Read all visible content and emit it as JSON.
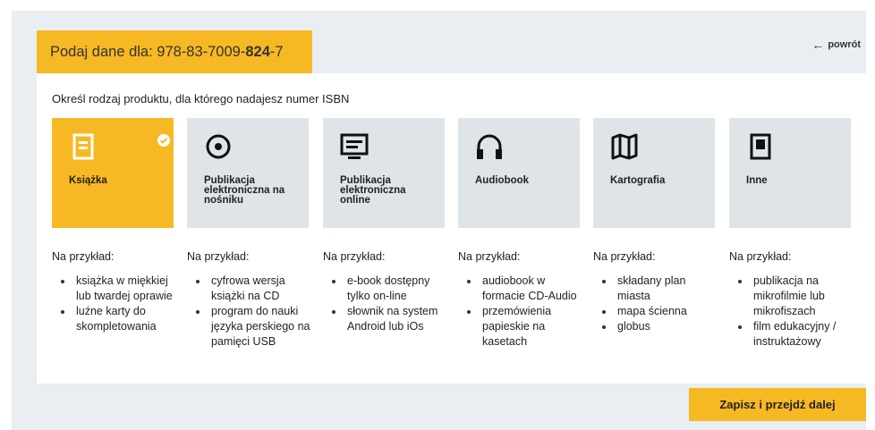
{
  "header": {
    "prefix": "Podaj dane dla: 978-83-7009-",
    "bold": "824",
    "suffix": "-7",
    "back_label": "powrót"
  },
  "intro": "Określ rodzaj produktu, dla którego nadajesz numer ISBN",
  "cards": [
    {
      "label": "Książka",
      "icon": "book-icon",
      "selected": true
    },
    {
      "label": "Publikacja elektroniczna na nośniku",
      "icon": "disc-icon",
      "selected": false
    },
    {
      "label": "Publikacja elektroniczna online",
      "icon": "monitor-icon",
      "selected": false
    },
    {
      "label": "Audiobook",
      "icon": "headphones-icon",
      "selected": false
    },
    {
      "label": "Kartografia",
      "icon": "map-icon",
      "selected": false
    },
    {
      "label": "Inne",
      "icon": "document-icon",
      "selected": false
    }
  ],
  "examples_title": "Na przykład:",
  "examples": [
    {
      "items": [
        "książka w miękkiej lub twardej oprawie",
        "luźne karty do skompletowania"
      ]
    },
    {
      "items": [
        "cyfrowa wersja książki na CD",
        "program do nauki języka perskiego na pamięci USB"
      ]
    },
    {
      "items": [
        "e-book dostępny tylko on-line",
        "słownik na system Android lub iOs"
      ]
    },
    {
      "items": [
        "audiobook w formacie CD-Audio",
        "przemówienia papieskie na kasetach"
      ]
    },
    {
      "items": [
        "składany plan miasta",
        "mapa ścienna",
        "globus"
      ]
    },
    {
      "items": [
        "publikacja na mikrofilmie lub mikrofiszach",
        "film edukacyjny / instruktażowy"
      ]
    }
  ],
  "save_label": "Zapisz i przejdź dalej",
  "colors": {
    "accent": "#f6b923",
    "card": "#dfe4e8",
    "background": "#e9eef2"
  }
}
